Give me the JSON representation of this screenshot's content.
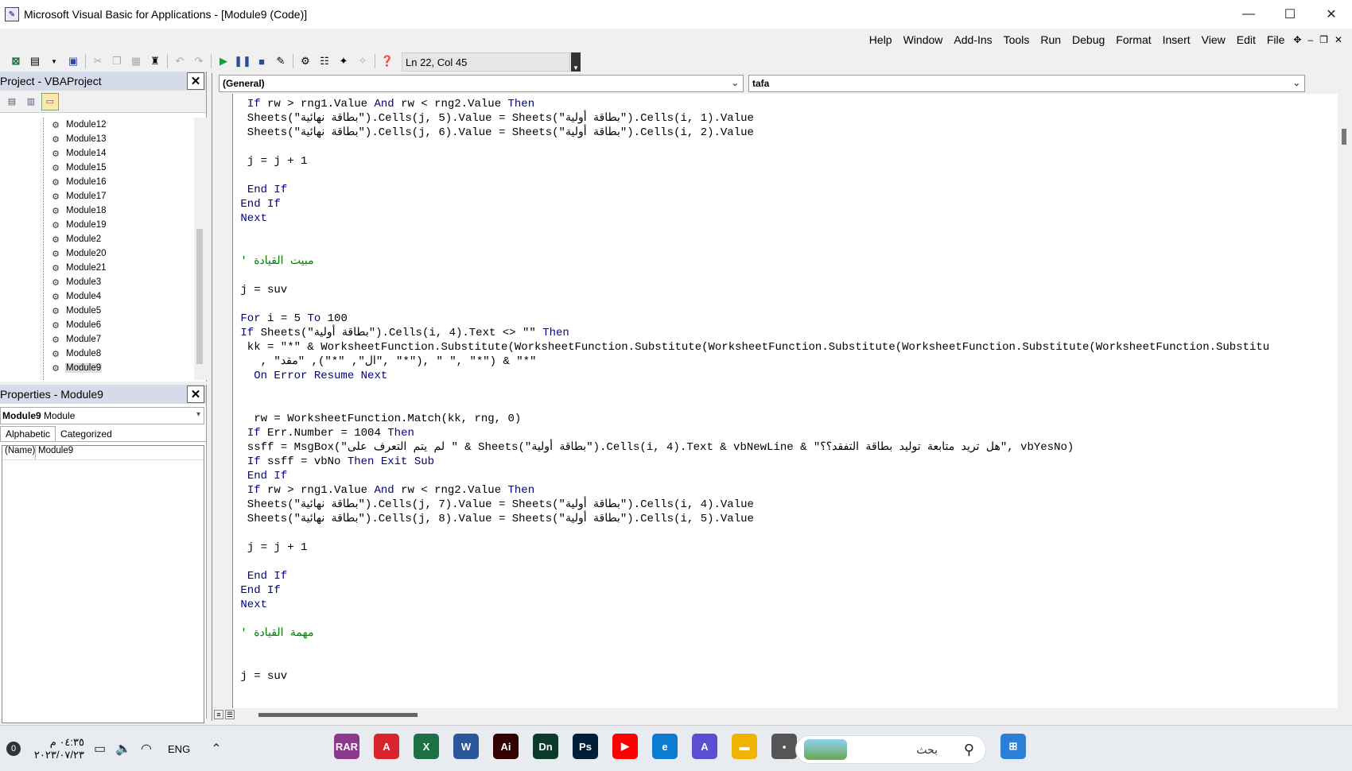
{
  "window": {
    "title": "Microsoft Visual Basic for Applications - [Module9 (Code)]",
    "controls": [
      "minimize-icon",
      "maximize-icon",
      "close-icon"
    ]
  },
  "menubar": {
    "items": [
      "Help",
      "Window",
      "Add-Ins",
      "Tools",
      "Run",
      "Debug",
      "Format",
      "Insert",
      "View",
      "Edit",
      "File"
    ]
  },
  "toolbar": {
    "status": "Ln 22, Col 45"
  },
  "project_panel": {
    "title": "Project - VBAProject",
    "modules": [
      "Module12",
      "Module13",
      "Module14",
      "Module15",
      "Module16",
      "Module17",
      "Module18",
      "Module19",
      "Module2",
      "Module20",
      "Module21",
      "Module3",
      "Module4",
      "Module5",
      "Module6",
      "Module7",
      "Module8",
      "Module9"
    ],
    "selected": "Module9"
  },
  "properties_panel": {
    "title": "Properties - Module9",
    "combo_name": "Module9",
    "combo_type": "Module",
    "tabs": [
      "Alphabetic",
      "Categorized"
    ],
    "active_tab": "Alphabetic",
    "row_key": "(Name)",
    "row_value": "Module9"
  },
  "code_window": {
    "object_combo": "(General)",
    "proc_combo": "tafa",
    "lines": [
      [
        {
          "t": "  "
        },
        {
          "t": "If",
          "k": "kw"
        },
        {
          "t": " rw > rng1.Value "
        },
        {
          "t": "And",
          "k": "kw"
        },
        {
          "t": " rw < rng2.Value "
        },
        {
          "t": "Then",
          "k": "kw"
        }
      ],
      [
        {
          "t": "  Sheets(\"بطاقة نهائية\").Cells(j, 5).Value = Sheets(\"بطاقة أولية\").Cells(i, 1).Value"
        }
      ],
      [
        {
          "t": "  Sheets(\"بطاقة نهائية\").Cells(j, 6).Value = Sheets(\"بطاقة أولية\").Cells(i, 2).Value"
        }
      ],
      [
        {
          "t": ""
        }
      ],
      [
        {
          "t": "  j = j + 1"
        }
      ],
      [
        {
          "t": ""
        }
      ],
      [
        {
          "t": "  "
        },
        {
          "t": "End If",
          "k": "kw"
        }
      ],
      [
        {
          "t": " "
        },
        {
          "t": "End If",
          "k": "kw"
        }
      ],
      [
        {
          "t": " "
        },
        {
          "t": "Next",
          "k": "kw"
        }
      ],
      [
        {
          "t": ""
        }
      ],
      [
        {
          "t": ""
        }
      ],
      [
        {
          "t": " ' مبيت القيادة",
          "k": "cm"
        }
      ],
      [
        {
          "t": ""
        }
      ],
      [
        {
          "t": " j = suv"
        }
      ],
      [
        {
          "t": ""
        }
      ],
      [
        {
          "t": " "
        },
        {
          "t": "For",
          "k": "kw"
        },
        {
          "t": " i = 5 "
        },
        {
          "t": "To",
          "k": "kw"
        },
        {
          "t": " 100"
        }
      ],
      [
        {
          "t": " "
        },
        {
          "t": "If",
          "k": "kw"
        },
        {
          "t": " Sheets(\"بطاقة أولية\").Cells(i, 4).Text <> \"\" "
        },
        {
          "t": "Then",
          "k": "kw"
        }
      ],
      [
        {
          "t": "  kk = \"*\" & WorksheetFunction.Substitute(WorksheetFunction.Substitute(WorksheetFunction.Substitute(WorksheetFunction.Substitute(WorksheetFunction.Substitu"
        }
      ],
      [
        {
          "t": "    , \"ال\", \"*\"), \"مقد\", \"*\"), \" \", \"*\") & \"*\""
        }
      ],
      [
        {
          "t": "   "
        },
        {
          "t": "On Error Resume Next",
          "k": "kw"
        }
      ],
      [
        {
          "t": ""
        }
      ],
      [
        {
          "t": ""
        }
      ],
      [
        {
          "t": "   rw = WorksheetFunction.Match(kk, rng, 0)"
        }
      ],
      [
        {
          "t": "  "
        },
        {
          "t": "If",
          "k": "kw"
        },
        {
          "t": " Err.Number = 1004 "
        },
        {
          "t": "Then",
          "k": "kw"
        }
      ],
      [
        {
          "t": "  ssff = MsgBox(\"لم يتم التعرف على \" & Sheets(\"بطاقة أولية\").Cells(i, 4).Text & vbNewLine & \"هل تريد متابعة توليد بطاقة التفقد؟؟\", vbYesNo)"
        }
      ],
      [
        {
          "t": "  "
        },
        {
          "t": "If",
          "k": "kw"
        },
        {
          "t": " ssff = vbNo "
        },
        {
          "t": "Then Exit Sub",
          "k": "kw"
        }
      ],
      [
        {
          "t": "  "
        },
        {
          "t": "End If",
          "k": "kw"
        }
      ],
      [
        {
          "t": "  "
        },
        {
          "t": "If",
          "k": "kw"
        },
        {
          "t": " rw > rng1.Value "
        },
        {
          "t": "And",
          "k": "kw"
        },
        {
          "t": " rw < rng2.Value "
        },
        {
          "t": "Then",
          "k": "kw"
        }
      ],
      [
        {
          "t": "  Sheets(\"بطاقة نهائية\").Cells(j, 7).Value = Sheets(\"بطاقة أولية\").Cells(i, 4).Value"
        }
      ],
      [
        {
          "t": "  Sheets(\"بطاقة نهائية\").Cells(j, 8).Value = Sheets(\"بطاقة أولية\").Cells(i, 5).Value"
        }
      ],
      [
        {
          "t": ""
        }
      ],
      [
        {
          "t": "  j = j + 1"
        }
      ],
      [
        {
          "t": ""
        }
      ],
      [
        {
          "t": "  "
        },
        {
          "t": "End If",
          "k": "kw"
        }
      ],
      [
        {
          "t": " "
        },
        {
          "t": "End If",
          "k": "kw"
        }
      ],
      [
        {
          "t": " "
        },
        {
          "t": "Next",
          "k": "kw"
        }
      ],
      [
        {
          "t": ""
        }
      ],
      [
        {
          "t": " ' مهمة القيادة",
          "k": "cm"
        }
      ],
      [
        {
          "t": ""
        }
      ],
      [
        {
          "t": ""
        }
      ],
      [
        {
          "t": " j = suv"
        }
      ]
    ]
  },
  "taskbar": {
    "time": "٠٤:٣٥ م",
    "date": "٢٠٢٣/٠٧/٢٣",
    "lang": "ENG",
    "notif_count": "0",
    "search_text": "بحث",
    "apps": [
      {
        "name": "winrar",
        "label": "RAR",
        "color": "#8b3a8b"
      },
      {
        "name": "acrobat",
        "label": "A",
        "color": "#d9242b"
      },
      {
        "name": "excel",
        "label": "X",
        "color": "#1d7044"
      },
      {
        "name": "word",
        "label": "W",
        "color": "#2b579a"
      },
      {
        "name": "illustrator",
        "label": "Ai",
        "color": "#330000"
      },
      {
        "name": "dimension",
        "label": "Dn",
        "color": "#0a3b2a"
      },
      {
        "name": "photoshop",
        "label": "Ps",
        "color": "#001e36"
      },
      {
        "name": "youtube",
        "label": "▶",
        "color": "#ff0000"
      },
      {
        "name": "edge",
        "label": "e",
        "color": "#0c7bd0"
      },
      {
        "name": "editor",
        "label": "A",
        "color": "#5a4fcf"
      },
      {
        "name": "explorer",
        "label": "▬",
        "color": "#f0b400"
      },
      {
        "name": "vba",
        "label": "▪",
        "color": "#555555"
      }
    ]
  }
}
